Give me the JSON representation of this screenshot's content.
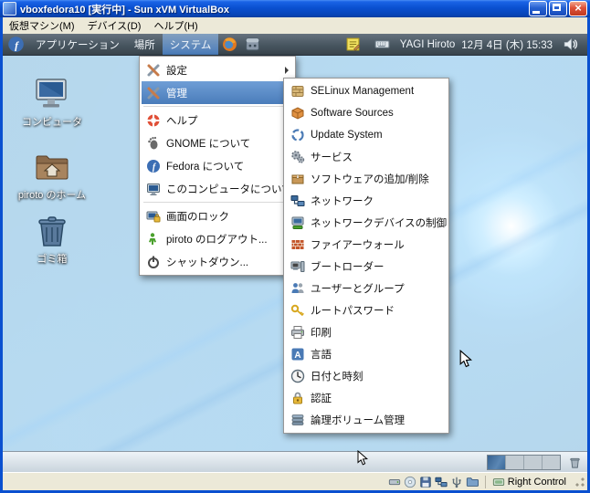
{
  "colors": {
    "titlebar": "#0a50d0",
    "close-button": "#c03a20",
    "panel-bg": "#47555f",
    "menu-highlight": "#4a7cba",
    "wallpaper-deep": "#0a1f3f",
    "orb-glow": "#cfeeff",
    "statusbar-bg": "#ece9d8",
    "fedora-blue": "#3c6eb4"
  },
  "window": {
    "title": "vboxfedora10 [実行中] - Sun xVM VirtualBox",
    "menu_items": [
      "仮想マシン(M)",
      "デバイス(D)",
      "ヘルプ(H)"
    ]
  },
  "top_panel": {
    "menus": [
      "アプリケーション",
      "場所",
      "システム"
    ],
    "user_name": "YAGI Hiroto",
    "clock": "12月 4日 (木) 15:33"
  },
  "desktop": {
    "icons": [
      {
        "label": "コンピュータ"
      },
      {
        "label": "piroto のホーム"
      },
      {
        "label": "ゴミ箱"
      }
    ]
  },
  "system_menu": {
    "items": [
      {
        "label": "設定"
      },
      {
        "label": "管理"
      },
      {
        "label": "ヘルプ"
      },
      {
        "label": "GNOME について"
      },
      {
        "label": "Fedora について"
      },
      {
        "label": "このコンピュータについて"
      },
      {
        "label": "画面のロック"
      },
      {
        "label": "piroto のログアウト..."
      },
      {
        "label": "シャットダウン..."
      }
    ]
  },
  "admin_submenu": {
    "items": [
      {
        "label": "SELinux Management"
      },
      {
        "label": "Software Sources"
      },
      {
        "label": "Update System"
      },
      {
        "label": "サービス"
      },
      {
        "label": "ソフトウェアの追加/削除"
      },
      {
        "label": "ネットワーク"
      },
      {
        "label": "ネットワークデバイスの制御"
      },
      {
        "label": "ファイアーウォール"
      },
      {
        "label": "ブートローダー"
      },
      {
        "label": "ユーザーとグループ"
      },
      {
        "label": "ルートパスワード"
      },
      {
        "label": "印刷"
      },
      {
        "label": "言語"
      },
      {
        "label": "日付と時刻"
      },
      {
        "label": "認証"
      },
      {
        "label": "論理ボリューム管理"
      }
    ]
  },
  "status_bar": {
    "host_key": "Right Control"
  }
}
